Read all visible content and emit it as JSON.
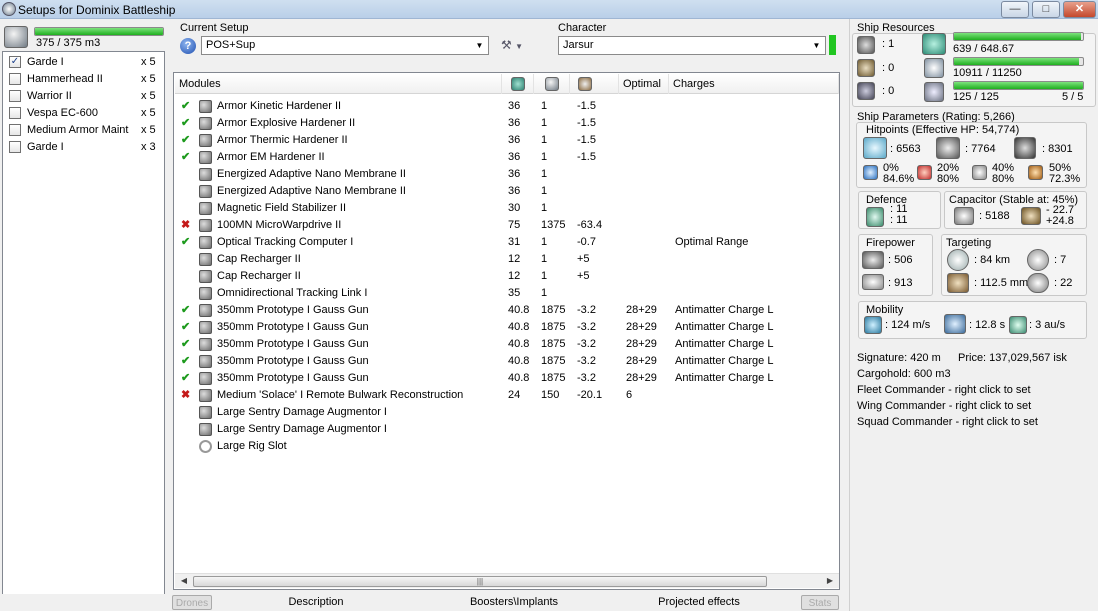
{
  "window": {
    "title": "Setups for Dominix Battleship"
  },
  "drones": {
    "bandwidth": "375 / 375 m3",
    "bandwidth_fraction": 1.0,
    "items": [
      {
        "name": "Garde I",
        "qty": "x 5",
        "checked": true
      },
      {
        "name": "Hammerhead II",
        "qty": "x 5",
        "checked": false
      },
      {
        "name": "Warrior II",
        "qty": "x 5",
        "checked": false
      },
      {
        "name": "Vespa EC-600",
        "qty": "x 5",
        "checked": false
      },
      {
        "name": "Medium Armor Maint...",
        "qty": "x 5",
        "checked": false
      },
      {
        "name": "Garde I",
        "qty": "x 3",
        "checked": false
      }
    ]
  },
  "setup": {
    "label": "Current Setup",
    "value": "POS+Sup"
  },
  "character": {
    "label": "Character",
    "value": "Jarsur"
  },
  "modules": {
    "headers": [
      "Modules",
      "",
      "",
      "",
      "Optimal",
      "Charges"
    ],
    "rows": [
      {
        "status": "ok",
        "name": "Armor Kinetic Hardener II",
        "c1": "36",
        "c2": "1",
        "c3": "-1.5",
        "optimal": "",
        "charges": ""
      },
      {
        "status": "ok",
        "name": "Armor Explosive Hardener II",
        "c1": "36",
        "c2": "1",
        "c3": "-1.5",
        "optimal": "",
        "charges": ""
      },
      {
        "status": "ok",
        "name": "Armor Thermic Hardener II",
        "c1": "36",
        "c2": "1",
        "c3": "-1.5",
        "optimal": "",
        "charges": ""
      },
      {
        "status": "ok",
        "name": "Armor EM Hardener II",
        "c1": "36",
        "c2": "1",
        "c3": "-1.5",
        "optimal": "",
        "charges": ""
      },
      {
        "status": "none",
        "name": "Energized Adaptive Nano Membrane II",
        "c1": "36",
        "c2": "1",
        "c3": "",
        "optimal": "",
        "charges": ""
      },
      {
        "status": "none",
        "name": "Energized Adaptive Nano Membrane II",
        "c1": "36",
        "c2": "1",
        "c3": "",
        "optimal": "",
        "charges": ""
      },
      {
        "status": "none",
        "name": "Magnetic Field Stabilizer II",
        "c1": "30",
        "c2": "1",
        "c3": "",
        "optimal": "",
        "charges": ""
      },
      {
        "status": "bad",
        "name": "100MN MicroWarpdrive II",
        "c1": "75",
        "c2": "1375",
        "c3": "-63.4",
        "optimal": "",
        "charges": ""
      },
      {
        "status": "ok",
        "name": "Optical Tracking Computer I",
        "c1": "31",
        "c2": "1",
        "c3": "-0.7",
        "optimal": "",
        "charges": "Optimal Range"
      },
      {
        "status": "none",
        "name": "Cap Recharger II",
        "c1": "12",
        "c2": "1",
        "c3": "+5",
        "optimal": "",
        "charges": ""
      },
      {
        "status": "none",
        "name": "Cap Recharger II",
        "c1": "12",
        "c2": "1",
        "c3": "+5",
        "optimal": "",
        "charges": ""
      },
      {
        "status": "none",
        "name": "Omnidirectional Tracking Link I",
        "c1": "35",
        "c2": "1",
        "c3": "",
        "optimal": "",
        "charges": ""
      },
      {
        "status": "ok",
        "name": "350mm Prototype I Gauss Gun",
        "c1": "40.8",
        "c2": "1875",
        "c3": "-3.2",
        "optimal": "28+29",
        "charges": "Antimatter Charge L"
      },
      {
        "status": "ok",
        "name": "350mm Prototype I Gauss Gun",
        "c1": "40.8",
        "c2": "1875",
        "c3": "-3.2",
        "optimal": "28+29",
        "charges": "Antimatter Charge L"
      },
      {
        "status": "ok",
        "name": "350mm Prototype I Gauss Gun",
        "c1": "40.8",
        "c2": "1875",
        "c3": "-3.2",
        "optimal": "28+29",
        "charges": "Antimatter Charge L"
      },
      {
        "status": "ok",
        "name": "350mm Prototype I Gauss Gun",
        "c1": "40.8",
        "c2": "1875",
        "c3": "-3.2",
        "optimal": "28+29",
        "charges": "Antimatter Charge L"
      },
      {
        "status": "ok",
        "name": "350mm Prototype I Gauss Gun",
        "c1": "40.8",
        "c2": "1875",
        "c3": "-3.2",
        "optimal": "28+29",
        "charges": "Antimatter Charge L"
      },
      {
        "status": "bad",
        "name": "Medium 'Solace' I Remote Bulwark Reconstruction",
        "c1": "24",
        "c2": "150",
        "c3": "-20.1",
        "optimal": "6",
        "charges": ""
      },
      {
        "status": "none",
        "name": "Large Sentry Damage Augmentor I",
        "c1": "",
        "c2": "",
        "c3": "",
        "optimal": "",
        "charges": ""
      },
      {
        "status": "none",
        "name": "Large Sentry Damage Augmentor I",
        "c1": "",
        "c2": "",
        "c3": "",
        "optimal": "",
        "charges": ""
      },
      {
        "status": "empty",
        "name": "Large Rig Slot",
        "c1": "",
        "c2": "",
        "c3": "",
        "optimal": "",
        "charges": ""
      }
    ]
  },
  "tabs": {
    "drones": "Drones",
    "description": "Description",
    "boosters": "Boosters\\Implants",
    "projected": "Projected effects",
    "stats": "Stats"
  },
  "resources": {
    "title": "Ship Resources",
    "turrets": ": 1",
    "launchers": ": 0",
    "calibration": ": 0",
    "cpu": "639 / 648.67",
    "cpu_fraction": 0.985,
    "power": "10911 / 11250",
    "power_fraction": 0.97,
    "drone_bay": "125 / 125",
    "drone_bay_fraction": 1.0,
    "drones_active": "5 / 5"
  },
  "params": {
    "title": "Ship Parameters (Rating: 5,266)",
    "hitpoints": "Hitpoints (Effective HP: 54,774)",
    "shield_hp": ": 6563",
    "armor_hp": ": 7764",
    "hull_hp": ": 8301",
    "res_em": [
      "0%",
      "84.6%"
    ],
    "res_th": [
      "20%",
      "80%"
    ],
    "res_ki": [
      "40%",
      "80%"
    ],
    "res_ex": [
      "50%",
      "72.3%"
    ],
    "defence": {
      "label": "Defence",
      "v1": ": 11",
      "v2": ": 11"
    },
    "capacitor": {
      "label": "Capacitor (Stable at: 45%)",
      "amount": ": 5188",
      "delta1": "- 22.7",
      "delta2": "+24.8"
    },
    "firepower": {
      "label": "Firepower",
      "v1": ": 506",
      "v2": ": 913"
    },
    "targeting": {
      "label": "Targeting",
      "range": ": 84 km",
      "targets": ": 7",
      "scan": ": 112.5 mm",
      "sig": ": 22"
    },
    "mobility": {
      "label": "Mobility",
      "speed": ": 124 m/s",
      "align": ": 12.8 s",
      "warp": ": 3 au/s"
    },
    "signature": "Signature: 420 m",
    "price": "Price: 137,029,567 isk",
    "cargo": "Cargohold: 600 m3",
    "fleet": "Fleet Commander - right click to set",
    "wing": "Wing Commander - right click to set",
    "squad": "Squad Commander - right click to set"
  }
}
